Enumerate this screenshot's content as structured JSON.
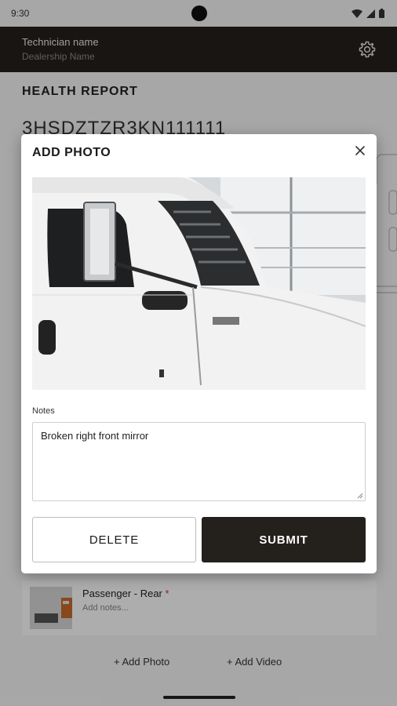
{
  "status_bar": {
    "time": "9:30"
  },
  "header": {
    "technician_name": "Technician name",
    "dealership_name": "Dealership Name"
  },
  "report": {
    "title": "HEALTH REPORT",
    "vin": "3HSDZTZR3KN111111"
  },
  "background_card": {
    "title": "Passenger - Rear",
    "required_marker": "*",
    "notes_placeholder": "Add notes..."
  },
  "actions": {
    "add_photo": "+ Add Photo",
    "add_video": "+ Add Video"
  },
  "dialog": {
    "title": "ADD PHOTO",
    "notes_label": "Notes",
    "notes_value": "Broken right front mirror",
    "delete_label": "DELETE",
    "submit_label": "SUBMIT"
  },
  "colors": {
    "header_bg": "#24201c",
    "primary_button": "#24201c",
    "required": "#c0392b"
  }
}
